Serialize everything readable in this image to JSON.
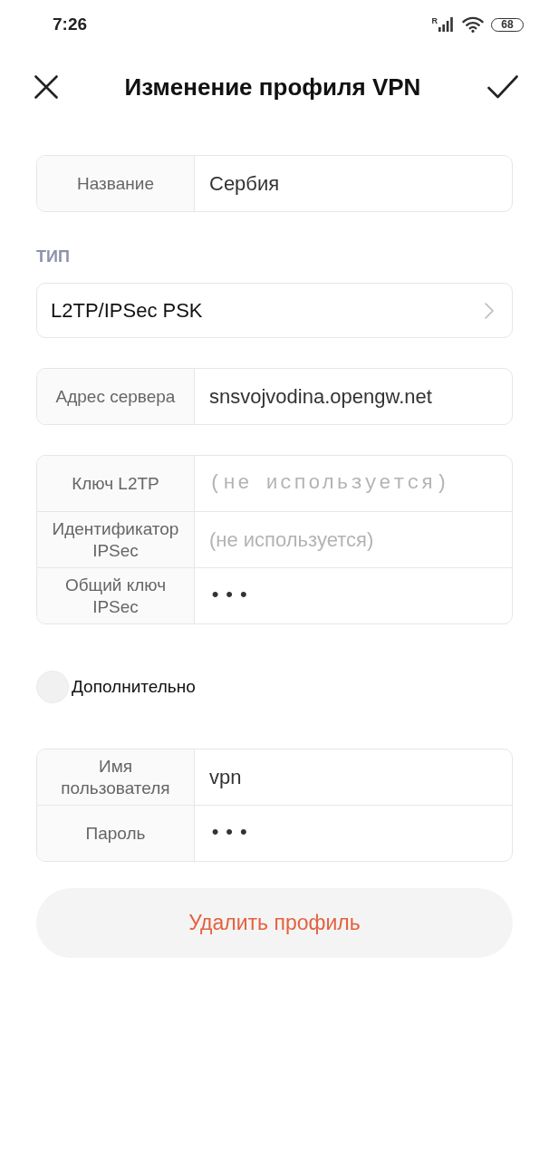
{
  "status_bar": {
    "time": "7:26",
    "roaming": "R",
    "battery": "68"
  },
  "header": {
    "title": "Изменение профиля VPN"
  },
  "form": [
    {
      "kind": "fields",
      "fields": [
        {
          "label": "Название",
          "kind": "text",
          "value": "Сербия"
        }
      ]
    },
    {
      "kind": "select",
      "heading": "ТИП",
      "value": "L2TP/IPSec PSK"
    },
    {
      "kind": "fields",
      "fields": [
        {
          "label": "Адрес сервера",
          "kind": "text",
          "value": "snsvojvodina.opengw.net"
        }
      ]
    },
    {
      "kind": "fields",
      "fields": [
        {
          "label": "Ключ L2TP",
          "kind": "password",
          "placeholder": "(не используется)"
        },
        {
          "label": "Идентификатор IPSec",
          "kind": "text",
          "placeholder": "(не используется)"
        },
        {
          "label": "Общий ключ IPSec",
          "kind": "password",
          "value": "•••"
        }
      ]
    },
    {
      "kind": "checkbox",
      "label": "Дополнительно",
      "checked": false
    },
    {
      "kind": "fields",
      "fields": [
        {
          "label": "Имя пользователя",
          "kind": "text",
          "value": "vpn"
        },
        {
          "label": "Пароль",
          "kind": "password",
          "value": "•••"
        }
      ]
    },
    {
      "kind": "button",
      "label": "Удалить профиль"
    }
  ]
}
